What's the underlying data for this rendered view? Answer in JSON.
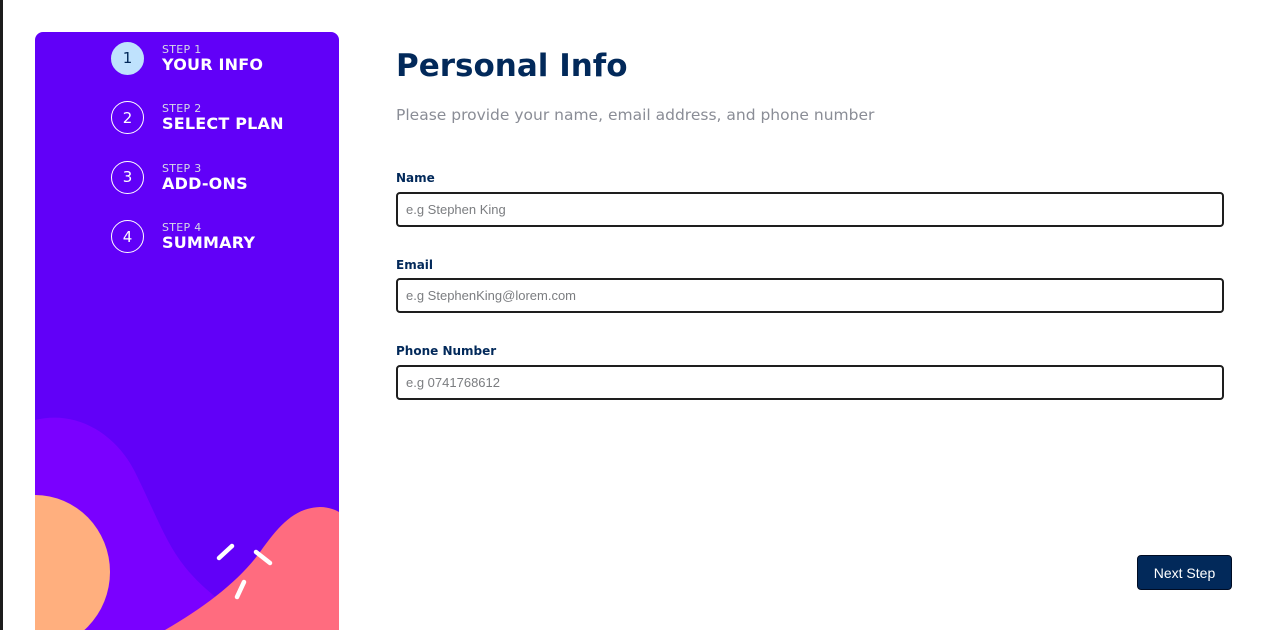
{
  "sidebar": {
    "steps": [
      {
        "number": "1",
        "label": "STEP 1",
        "name": "YOUR INFO"
      },
      {
        "number": "2",
        "label": "STEP 2",
        "name": "SELECT PLAN"
      },
      {
        "number": "3",
        "label": "STEP 3",
        "name": "ADD-ONS"
      },
      {
        "number": "4",
        "label": "STEP 4",
        "name": "SUMMARY"
      }
    ],
    "active_step": 1
  },
  "main": {
    "title": "Personal Info",
    "subtitle": "Please provide your name, email address, and phone number",
    "fields": [
      {
        "label": "Name",
        "placeholder": "e.g Stephen King",
        "value": ""
      },
      {
        "label": "Email",
        "placeholder": "e.g StephenKing@lorem.com",
        "value": ""
      },
      {
        "label": "Phone Number",
        "placeholder": "e.g 0741768612",
        "value": ""
      }
    ],
    "next_button": "Next Step"
  },
  "colors": {
    "sidebar_bg": "#6100f8",
    "active_step_bg": "#bfe2fd",
    "primary": "#02295a",
    "orange_blob": "#ffaf7e",
    "pink_blob": "#ff6c7f",
    "purple_blob": "#7a00ff"
  }
}
